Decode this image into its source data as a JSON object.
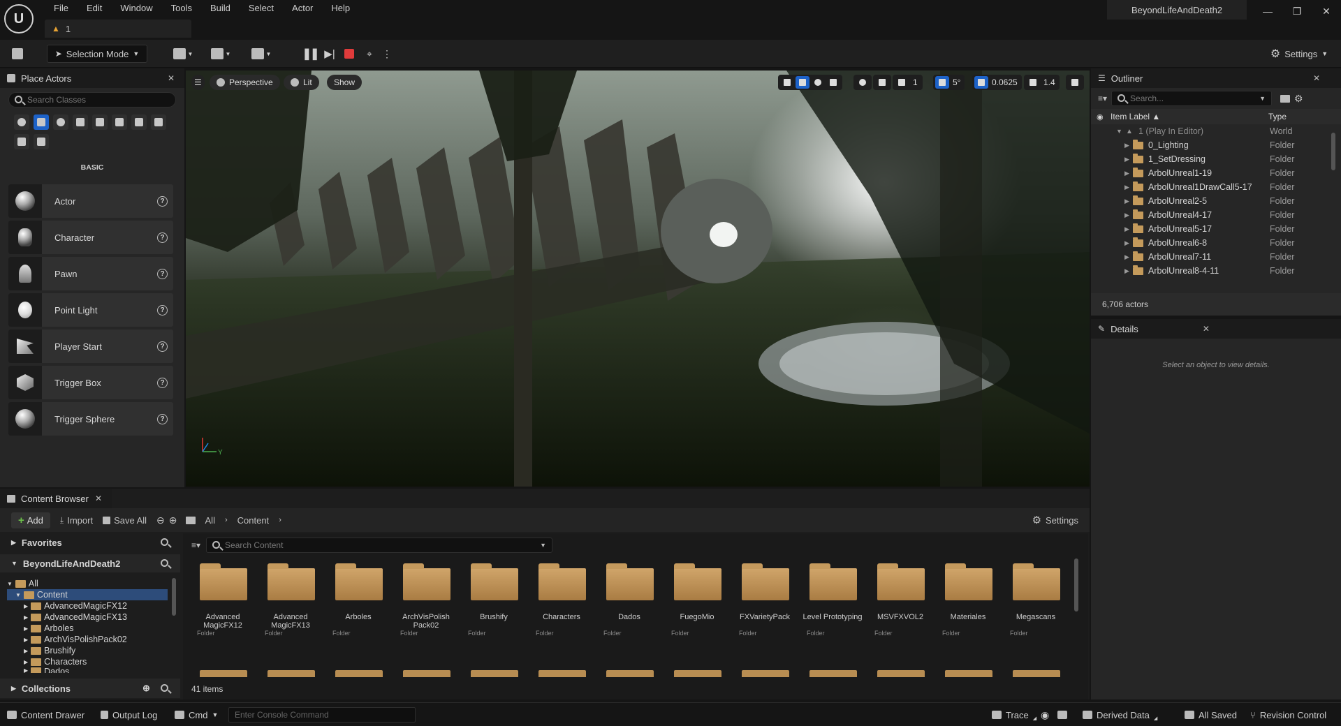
{
  "app": {
    "project_title": "BeyondLifeAndDeath2",
    "level_tab": "1",
    "menu": [
      "File",
      "Edit",
      "Window",
      "Tools",
      "Build",
      "Select",
      "Actor",
      "Help"
    ]
  },
  "toolbar": {
    "selection_mode": "Selection Mode",
    "settings": "Settings"
  },
  "place_actors": {
    "tab": "Place Actors",
    "search_placeholder": "Search Classes",
    "section": "BASIC",
    "items": [
      {
        "label": "Actor"
      },
      {
        "label": "Character"
      },
      {
        "label": "Pawn"
      },
      {
        "label": "Point Light"
      },
      {
        "label": "Player Start"
      },
      {
        "label": "Trigger Box"
      },
      {
        "label": "Trigger Sphere"
      }
    ]
  },
  "viewport": {
    "perspective": "Perspective",
    "lit": "Lit",
    "show": "Show",
    "grid_size": "1",
    "angle_snap": "5°",
    "scale_snap": "0.0625",
    "camera_speed": "1.4"
  },
  "outliner": {
    "tab": "Outliner",
    "search_placeholder": "Search...",
    "col_label": "Item Label ▲",
    "col_type": "Type",
    "world_row": {
      "label": "1 (Play In Editor)",
      "type": "World"
    },
    "rows": [
      {
        "label": "0_Lighting",
        "type": "Folder"
      },
      {
        "label": "1_SetDressing",
        "type": "Folder"
      },
      {
        "label": "ArbolUnreal1-19",
        "type": "Folder"
      },
      {
        "label": "ArbolUnreal1DrawCall5-17",
        "type": "Folder"
      },
      {
        "label": "ArbolUnreal2-5",
        "type": "Folder"
      },
      {
        "label": "ArbolUnreal4-17",
        "type": "Folder"
      },
      {
        "label": "ArbolUnreal5-17",
        "type": "Folder"
      },
      {
        "label": "ArbolUnreal6-8",
        "type": "Folder"
      },
      {
        "label": "ArbolUnreal7-11",
        "type": "Folder"
      },
      {
        "label": "ArbolUnreal8-4-11",
        "type": "Folder"
      }
    ],
    "actor_count": "6,706 actors"
  },
  "details": {
    "tab": "Details",
    "empty_message": "Select an object to view details."
  },
  "content_browser": {
    "tab": "Content Browser",
    "add": "Add",
    "import": "Import",
    "save_all": "Save All",
    "path": [
      "All",
      "Content"
    ],
    "settings": "Settings",
    "search_placeholder": "Search Content",
    "favorites": "Favorites",
    "project": "BeyondLifeAndDeath2",
    "collections": "Collections",
    "tree": [
      "All",
      "Content",
      "AdvancedMagicFX12",
      "AdvancedMagicFX13",
      "Arboles",
      "ArchVisPolishPack02",
      "Brushify",
      "Characters",
      "Dados"
    ],
    "folders": [
      {
        "name": "Advanced MagicFX12",
        "kind": "Folder"
      },
      {
        "name": "Advanced MagicFX13",
        "kind": "Folder"
      },
      {
        "name": "Arboles",
        "kind": "Folder"
      },
      {
        "name": "ArchVisPolish Pack02",
        "kind": "Folder"
      },
      {
        "name": "Brushify",
        "kind": "Folder"
      },
      {
        "name": "Characters",
        "kind": "Folder"
      },
      {
        "name": "Dados",
        "kind": "Folder"
      },
      {
        "name": "FuegoMio",
        "kind": "Folder"
      },
      {
        "name": "FXVarietyPack",
        "kind": "Folder"
      },
      {
        "name": "Level Prototyping",
        "kind": "Folder"
      },
      {
        "name": "MSVFXVOL2",
        "kind": "Folder"
      },
      {
        "name": "Materiales",
        "kind": "Folder"
      },
      {
        "name": "Megascans",
        "kind": "Folder"
      }
    ],
    "item_count": "41 items"
  },
  "statusbar": {
    "content_drawer": "Content Drawer",
    "output_log": "Output Log",
    "cmd": "Cmd",
    "console_placeholder": "Enter Console Command",
    "trace": "Trace",
    "derived_data": "Derived Data",
    "all_saved": "All Saved",
    "revision_control": "Revision Control"
  },
  "colors": {
    "accent": "#1d62c8",
    "folder": "#c49a5b",
    "stop": "#e03b3b",
    "warning": "#e7a334"
  }
}
